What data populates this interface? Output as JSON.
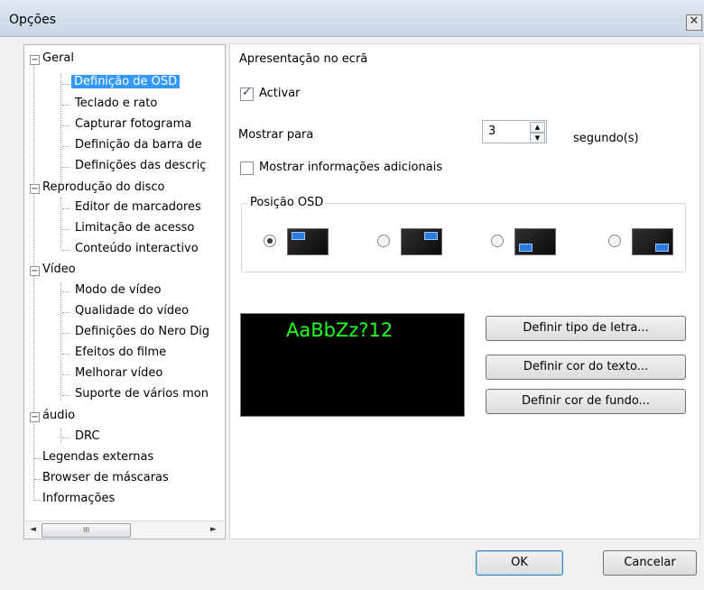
{
  "window": {
    "title": "Opções",
    "close_glyph": "✕"
  },
  "tree": {
    "items": [
      {
        "label": "Geral"
      },
      {
        "label": "Definição de OSD"
      },
      {
        "label": "Teclado e rato"
      },
      {
        "label": "Capturar fotograma"
      },
      {
        "label": "Definição da barra de"
      },
      {
        "label": "Definições das descriç"
      },
      {
        "label": "Reprodução do disco"
      },
      {
        "label": "Editor de marcadores"
      },
      {
        "label": "Limitação de acesso"
      },
      {
        "label": "Conteúdo interactivo"
      },
      {
        "label": "Vídeo"
      },
      {
        "label": "Modo de vídeo"
      },
      {
        "label": "Qualidade do vídeo"
      },
      {
        "label": "Definições do Nero Dig"
      },
      {
        "label": "Efeitos do filme"
      },
      {
        "label": "Melhorar vídeo"
      },
      {
        "label": "Suporte de vários mon"
      },
      {
        "label": "áudio"
      },
      {
        "label": "DRC"
      },
      {
        "label": "Legendas externas"
      },
      {
        "label": "Browser de máscaras"
      },
      {
        "label": "Informações"
      }
    ],
    "scroll_left": "◄",
    "scroll_right": "►",
    "scroll_thumb": "III"
  },
  "osd": {
    "group_title": "Apresentação no ecrã",
    "activate_label": "Activar",
    "activate_checked": true,
    "show_for_label": "Mostrar para",
    "show_for_value": "3",
    "seconds_label": "segundo(s)",
    "extra_info_label": "Mostrar informações adicionais",
    "extra_info_checked": false,
    "position_title": "Posição OSD",
    "selected_position": 0
  },
  "preview": {
    "text": "AaBbZz?12",
    "text_color": "#22ff22",
    "background": "#000000"
  },
  "buttons": {
    "font": "Definir tipo de letra...",
    "text_color": "Definir cor do texto...",
    "bg_color": "Definir cor de fundo...",
    "ok": "OK",
    "cancel": "Cancelar"
  }
}
